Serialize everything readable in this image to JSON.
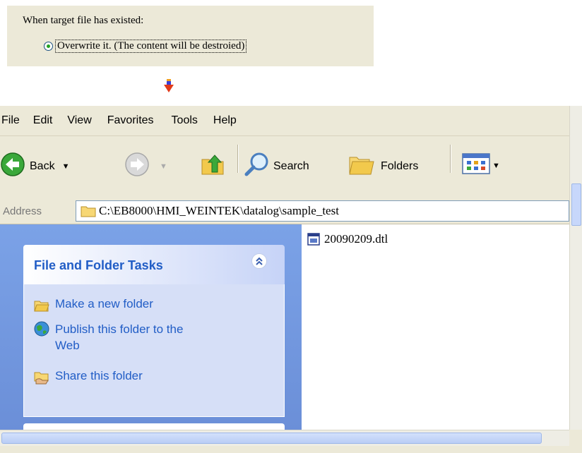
{
  "dialog": {
    "label": "When target file has existed:",
    "option_label": "Overwrite it. (The content will be destroied)",
    "option_selected": true
  },
  "menu": [
    "File",
    "Edit",
    "View",
    "Favorites",
    "Tools",
    "Help"
  ],
  "toolbar": {
    "back_label": "Back",
    "search_label": "Search",
    "folders_label": "Folders",
    "icons": [
      "back-arrow-icon",
      "forward-arrow-icon",
      "up-folder-icon",
      "search-magnifier-icon",
      "folders-icon",
      "views-icon"
    ]
  },
  "address": {
    "label": "Address",
    "path": "C:\\EB8000\\HMI_WEINTEK\\datalog\\sample_test"
  },
  "task_pane": {
    "title": "File and Folder Tasks",
    "links": [
      {
        "label": "Make a new folder",
        "icon": "new-folder-icon"
      },
      {
        "label": "Publish this folder to the Web",
        "icon": "publish-web-icon"
      },
      {
        "label": "Share this folder",
        "icon": "share-folder-icon"
      }
    ]
  },
  "files": [
    {
      "name": "20090209.dtl",
      "icon": "datalog-file-icon"
    }
  ],
  "colors": {
    "window_face": "#ece9d8",
    "task_pane_blue": "#7ba2e7",
    "task_title_blue": "#215dc6",
    "task_body": "#d6dff7"
  }
}
